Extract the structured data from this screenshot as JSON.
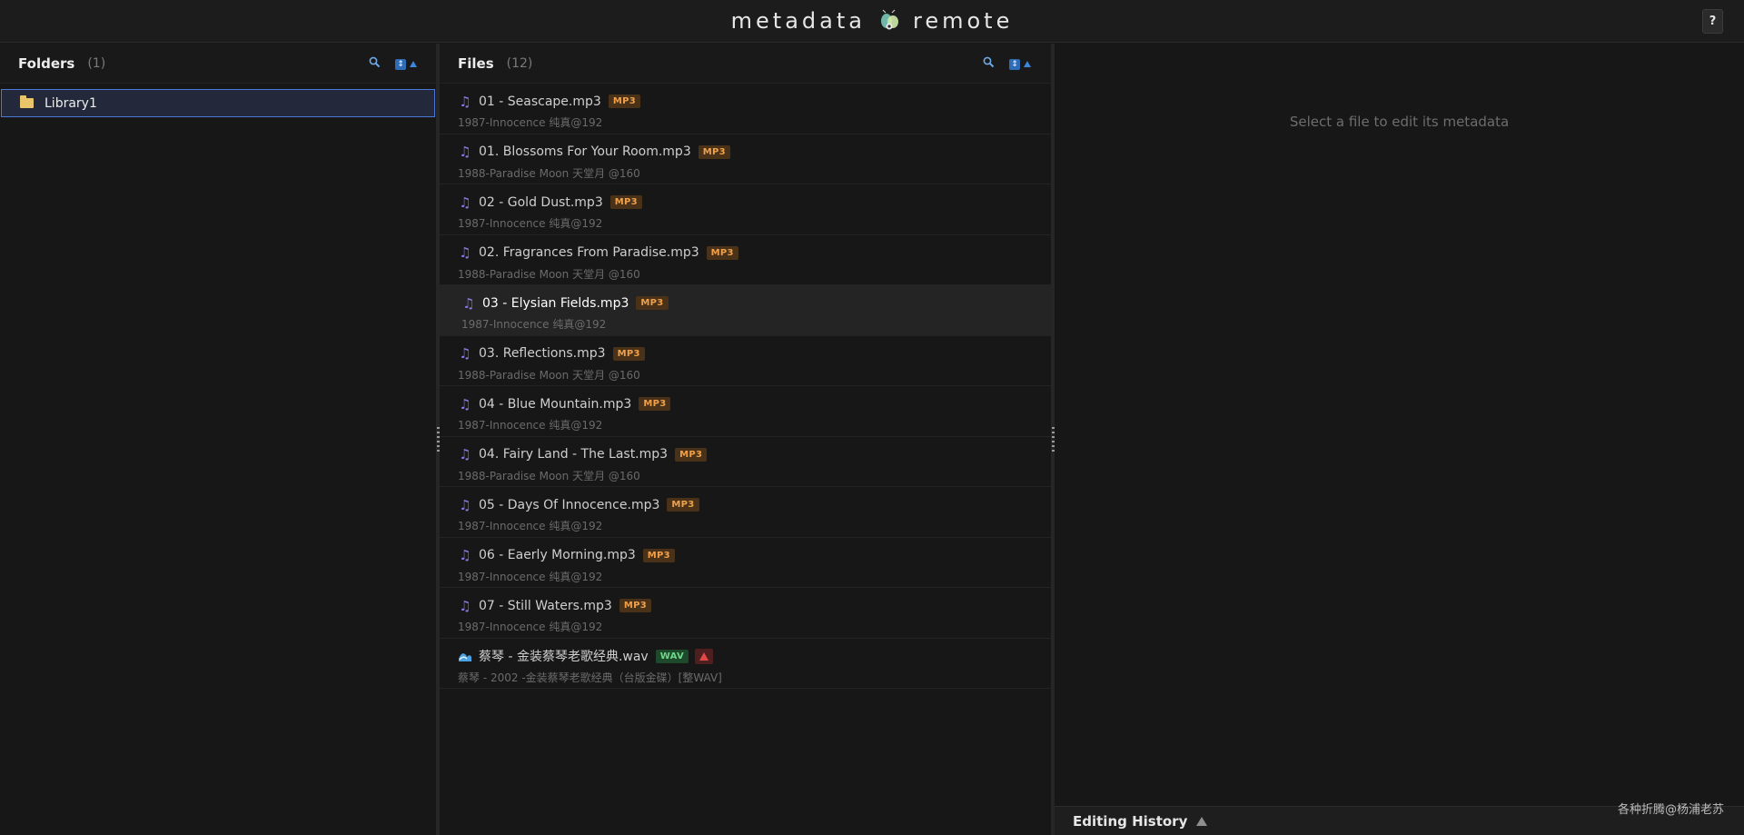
{
  "header": {
    "title_left": "metadata",
    "title_right": "remote",
    "logo_icon": "cicada-logo-icon",
    "help_label": "?"
  },
  "folders": {
    "title": "Folders",
    "count": "(1)",
    "items": [
      {
        "label": "Library1",
        "icon": "folder-icon"
      }
    ]
  },
  "files": {
    "title": "Files",
    "count": "(12)",
    "items": [
      {
        "name": "01 - Seascape.mp3",
        "badge": "MP3",
        "sub": "1987-Innocence 纯真@192"
      },
      {
        "name": "01. Blossoms For Your Room.mp3",
        "badge": "MP3",
        "sub": "1988-Paradise Moon 天堂月 @160"
      },
      {
        "name": "02 - Gold Dust.mp3",
        "badge": "MP3",
        "sub": "1987-Innocence 纯真@192"
      },
      {
        "name": "02. Fragrances From Paradise.mp3",
        "badge": "MP3",
        "sub": "1988-Paradise Moon 天堂月 @160"
      },
      {
        "name": "03 - Elysian Fields.mp3",
        "badge": "MP3",
        "sub": "1987-Innocence 纯真@192"
      },
      {
        "name": "03. Reflections.mp3",
        "badge": "MP3",
        "sub": "1988-Paradise Moon 天堂月 @160"
      },
      {
        "name": "04 - Blue Mountain.mp3",
        "badge": "MP3",
        "sub": "1987-Innocence 纯真@192"
      },
      {
        "name": "04. Fairy Land - The Last.mp3",
        "badge": "MP3",
        "sub": "1988-Paradise Moon 天堂月 @160"
      },
      {
        "name": "05 - Days Of Innocence.mp3",
        "badge": "MP3",
        "sub": "1987-Innocence 纯真@192"
      },
      {
        "name": "06 - Eaerly Morning.mp3",
        "badge": "MP3",
        "sub": "1987-Innocence 纯真@192"
      },
      {
        "name": "07 - Still Waters.mp3",
        "badge": "MP3",
        "sub": "1987-Innocence 纯真@192"
      },
      {
        "name": "蔡琴 - 金装蔡琴老歌经典.wav",
        "badge": "WAV",
        "sub": "蔡琴 - 2002 -金装蔡琴老歌经典（台版金碟）[整WAV]"
      }
    ]
  },
  "editor": {
    "placeholder": "Select a file to edit its metadata",
    "history_label": "Editing History"
  },
  "watermark": "各种折腾@杨浦老苏",
  "colors": {
    "accent": "#4a78d8",
    "mp3_badge": "#f0a04a",
    "wav_badge": "#6fd68a",
    "warning": "#e04848",
    "note_icon": "#8a78e6"
  }
}
